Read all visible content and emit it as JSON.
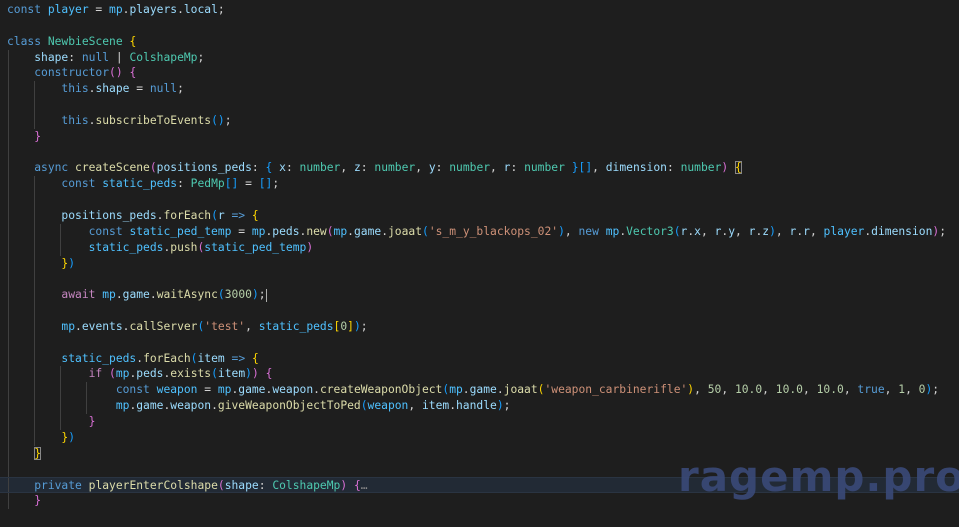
{
  "editor": {
    "lines": [
      {
        "indent": 0,
        "tokens": [
          [
            "kw",
            "const "
          ],
          [
            "var",
            "player"
          ],
          [
            "pl",
            " = "
          ],
          [
            "var",
            "mp"
          ],
          [
            "pl",
            "."
          ],
          [
            "prop",
            "players"
          ],
          [
            "pl",
            "."
          ],
          [
            "prop",
            "local"
          ],
          [
            "pl",
            ";"
          ]
        ]
      },
      {
        "indent": 0,
        "tokens": []
      },
      {
        "indent": 0,
        "tokens": [
          [
            "kw",
            "class "
          ],
          [
            "cls",
            "NewbieScene"
          ],
          [
            "pl",
            " "
          ],
          [
            "b1",
            "{"
          ]
        ]
      },
      {
        "indent": 1,
        "tokens": [
          [
            "prop",
            "shape"
          ],
          [
            "pl",
            ": "
          ],
          [
            "kw",
            "null"
          ],
          [
            "pl",
            " | "
          ],
          [
            "cls",
            "ColshapeMp"
          ],
          [
            "pl",
            ";"
          ]
        ]
      },
      {
        "indent": 1,
        "tokens": [
          [
            "kw",
            "constructor"
          ],
          [
            "b2",
            "()"
          ],
          [
            "pl",
            " "
          ],
          [
            "b2",
            "{"
          ]
        ]
      },
      {
        "indent": 2,
        "tokens": [
          [
            "kw",
            "this"
          ],
          [
            "pl",
            "."
          ],
          [
            "prop",
            "shape"
          ],
          [
            "pl",
            " = "
          ],
          [
            "kw",
            "null"
          ],
          [
            "pl",
            ";"
          ]
        ]
      },
      {
        "indent": 2,
        "tokens": []
      },
      {
        "indent": 2,
        "tokens": [
          [
            "kw",
            "this"
          ],
          [
            "pl",
            "."
          ],
          [
            "fn",
            "subscribeToEvents"
          ],
          [
            "b3",
            "()"
          ],
          [
            "pl",
            ";"
          ]
        ]
      },
      {
        "indent": 1,
        "tokens": [
          [
            "b2",
            "}"
          ]
        ]
      },
      {
        "indent": 1,
        "tokens": []
      },
      {
        "indent": 1,
        "tokens": [
          [
            "kw",
            "async "
          ],
          [
            "fn",
            "createScene"
          ],
          [
            "b2",
            "("
          ],
          [
            "prop",
            "positions_peds"
          ],
          [
            "pl",
            ": "
          ],
          [
            "b3",
            "{"
          ],
          [
            "pl",
            " "
          ],
          [
            "prop",
            "x"
          ],
          [
            "pl",
            ": "
          ],
          [
            "cls",
            "number"
          ],
          [
            "pl",
            ", "
          ],
          [
            "prop",
            "z"
          ],
          [
            "pl",
            ": "
          ],
          [
            "cls",
            "number"
          ],
          [
            "pl",
            ", "
          ],
          [
            "prop",
            "y"
          ],
          [
            "pl",
            ": "
          ],
          [
            "cls",
            "number"
          ],
          [
            "pl",
            ", "
          ],
          [
            "prop",
            "r"
          ],
          [
            "pl",
            ": "
          ],
          [
            "cls",
            "number"
          ],
          [
            "pl",
            " "
          ],
          [
            "b3",
            "}"
          ],
          [
            "b3",
            "[]"
          ],
          [
            "pl",
            ", "
          ],
          [
            "prop",
            "dimension"
          ],
          [
            "pl",
            ": "
          ],
          [
            "cls",
            "number"
          ],
          [
            "b2",
            ")"
          ],
          [
            "pl",
            " "
          ],
          [
            "b2m",
            "{"
          ]
        ]
      },
      {
        "indent": 2,
        "tokens": [
          [
            "kw",
            "const "
          ],
          [
            "var",
            "static_peds"
          ],
          [
            "pl",
            ": "
          ],
          [
            "cls",
            "PedMp"
          ],
          [
            "b3",
            "[]"
          ],
          [
            "pl",
            " = "
          ],
          [
            "b3",
            "[]"
          ],
          [
            "pl",
            ";"
          ]
        ]
      },
      {
        "indent": 2,
        "tokens": []
      },
      {
        "indent": 2,
        "tokens": [
          [
            "prop",
            "positions_peds"
          ],
          [
            "pl",
            "."
          ],
          [
            "fn",
            "forEach"
          ],
          [
            "b3",
            "("
          ],
          [
            "prop",
            "r"
          ],
          [
            "pl",
            " "
          ],
          [
            "kw",
            "=>"
          ],
          [
            "pl",
            " "
          ],
          [
            "b1",
            "{"
          ]
        ]
      },
      {
        "indent": 3,
        "tokens": [
          [
            "kw",
            "const "
          ],
          [
            "var",
            "static_ped_temp"
          ],
          [
            "pl",
            " = "
          ],
          [
            "var",
            "mp"
          ],
          [
            "pl",
            "."
          ],
          [
            "prop",
            "peds"
          ],
          [
            "pl",
            "."
          ],
          [
            "fn",
            "new"
          ],
          [
            "b2",
            "("
          ],
          [
            "var",
            "mp"
          ],
          [
            "pl",
            "."
          ],
          [
            "prop",
            "game"
          ],
          [
            "pl",
            "."
          ],
          [
            "fn",
            "joaat"
          ],
          [
            "b3",
            "("
          ],
          [
            "str",
            "'s_m_y_blackops_02'"
          ],
          [
            "b3",
            ")"
          ],
          [
            "pl",
            ", "
          ],
          [
            "kw",
            "new "
          ],
          [
            "var",
            "mp"
          ],
          [
            "pl",
            "."
          ],
          [
            "cls",
            "Vector3"
          ],
          [
            "b3",
            "("
          ],
          [
            "prop",
            "r"
          ],
          [
            "pl",
            "."
          ],
          [
            "prop",
            "x"
          ],
          [
            "pl",
            ", "
          ],
          [
            "prop",
            "r"
          ],
          [
            "pl",
            "."
          ],
          [
            "prop",
            "y"
          ],
          [
            "pl",
            ", "
          ],
          [
            "prop",
            "r"
          ],
          [
            "pl",
            "."
          ],
          [
            "prop",
            "z"
          ],
          [
            "b3",
            ")"
          ],
          [
            "pl",
            ", "
          ],
          [
            "prop",
            "r"
          ],
          [
            "pl",
            "."
          ],
          [
            "prop",
            "r"
          ],
          [
            "pl",
            ", "
          ],
          [
            "var",
            "player"
          ],
          [
            "pl",
            "."
          ],
          [
            "prop",
            "dimension"
          ],
          [
            "b2",
            ")"
          ],
          [
            "pl",
            ";"
          ]
        ]
      },
      {
        "indent": 3,
        "tokens": [
          [
            "var",
            "static_peds"
          ],
          [
            "pl",
            "."
          ],
          [
            "fn",
            "push"
          ],
          [
            "b2",
            "("
          ],
          [
            "var",
            "static_ped_temp"
          ],
          [
            "b2",
            ")"
          ]
        ]
      },
      {
        "indent": 2,
        "tokens": [
          [
            "b1",
            "}"
          ],
          [
            "b3",
            ")"
          ]
        ]
      },
      {
        "indent": 2,
        "tokens": []
      },
      {
        "indent": 2,
        "tokens": [
          [
            "ctl",
            "await "
          ],
          [
            "var",
            "mp"
          ],
          [
            "pl",
            "."
          ],
          [
            "prop",
            "game"
          ],
          [
            "pl",
            "."
          ],
          [
            "fn",
            "waitAsync"
          ],
          [
            "b3",
            "("
          ],
          [
            "num",
            "3000"
          ],
          [
            "b3",
            ")"
          ],
          [
            "pl",
            ";"
          ],
          [
            "cursor",
            ""
          ]
        ]
      },
      {
        "indent": 2,
        "tokens": []
      },
      {
        "indent": 2,
        "tokens": [
          [
            "var",
            "mp"
          ],
          [
            "pl",
            "."
          ],
          [
            "prop",
            "events"
          ],
          [
            "pl",
            "."
          ],
          [
            "fn",
            "callServer"
          ],
          [
            "b3",
            "("
          ],
          [
            "str",
            "'test'"
          ],
          [
            "pl",
            ", "
          ],
          [
            "var",
            "static_peds"
          ],
          [
            "b1",
            "["
          ],
          [
            "num",
            "0"
          ],
          [
            "b1",
            "]"
          ],
          [
            "b3",
            ")"
          ],
          [
            "pl",
            ";"
          ]
        ]
      },
      {
        "indent": 2,
        "tokens": []
      },
      {
        "indent": 2,
        "tokens": [
          [
            "var",
            "static_peds"
          ],
          [
            "pl",
            "."
          ],
          [
            "fn",
            "forEach"
          ],
          [
            "b3",
            "("
          ],
          [
            "prop",
            "item"
          ],
          [
            "pl",
            " "
          ],
          [
            "kw",
            "=>"
          ],
          [
            "pl",
            " "
          ],
          [
            "b1",
            "{"
          ]
        ]
      },
      {
        "indent": 3,
        "tokens": [
          [
            "ctl",
            "if "
          ],
          [
            "b2",
            "("
          ],
          [
            "var",
            "mp"
          ],
          [
            "pl",
            "."
          ],
          [
            "prop",
            "peds"
          ],
          [
            "pl",
            "."
          ],
          [
            "fn",
            "exists"
          ],
          [
            "b3",
            "("
          ],
          [
            "prop",
            "item"
          ],
          [
            "b3",
            ")"
          ],
          [
            "b2",
            ")"
          ],
          [
            "pl",
            " "
          ],
          [
            "b2",
            "{"
          ]
        ]
      },
      {
        "indent": 4,
        "tokens": [
          [
            "kw",
            "const "
          ],
          [
            "var",
            "weapon"
          ],
          [
            "pl",
            " = "
          ],
          [
            "var",
            "mp"
          ],
          [
            "pl",
            "."
          ],
          [
            "prop",
            "game"
          ],
          [
            "pl",
            "."
          ],
          [
            "prop",
            "weapon"
          ],
          [
            "pl",
            "."
          ],
          [
            "fn",
            "createWeaponObject"
          ],
          [
            "b3",
            "("
          ],
          [
            "var",
            "mp"
          ],
          [
            "pl",
            "."
          ],
          [
            "prop",
            "game"
          ],
          [
            "pl",
            "."
          ],
          [
            "fn",
            "joaat"
          ],
          [
            "b1",
            "("
          ],
          [
            "str",
            "'weapon_carbinerifle'"
          ],
          [
            "b1",
            ")"
          ],
          [
            "pl",
            ", "
          ],
          [
            "num",
            "50"
          ],
          [
            "pl",
            ", "
          ],
          [
            "num",
            "10.0"
          ],
          [
            "pl",
            ", "
          ],
          [
            "num",
            "10.0"
          ],
          [
            "pl",
            ", "
          ],
          [
            "num",
            "10.0"
          ],
          [
            "pl",
            ", "
          ],
          [
            "kw",
            "true"
          ],
          [
            "pl",
            ", "
          ],
          [
            "num",
            "1"
          ],
          [
            "pl",
            ", "
          ],
          [
            "num",
            "0"
          ],
          [
            "b3",
            ")"
          ],
          [
            "pl",
            ";"
          ]
        ]
      },
      {
        "indent": 4,
        "tokens": [
          [
            "var",
            "mp"
          ],
          [
            "pl",
            "."
          ],
          [
            "prop",
            "game"
          ],
          [
            "pl",
            "."
          ],
          [
            "prop",
            "weapon"
          ],
          [
            "pl",
            "."
          ],
          [
            "fn",
            "giveWeaponObjectToPed"
          ],
          [
            "b3",
            "("
          ],
          [
            "var",
            "weapon"
          ],
          [
            "pl",
            ", "
          ],
          [
            "prop",
            "item"
          ],
          [
            "pl",
            "."
          ],
          [
            "prop",
            "handle"
          ],
          [
            "b3",
            ")"
          ],
          [
            "pl",
            ";"
          ]
        ]
      },
      {
        "indent": 3,
        "tokens": [
          [
            "b2",
            "}"
          ]
        ]
      },
      {
        "indent": 2,
        "tokens": [
          [
            "b1",
            "}"
          ],
          [
            "b3",
            ")"
          ]
        ]
      },
      {
        "indent": 1,
        "tokens": [
          [
            "b2m",
            "}"
          ]
        ]
      },
      {
        "indent": 1,
        "tokens": []
      },
      {
        "indent": 1,
        "highlight": true,
        "tokens": [
          [
            "kw",
            "private "
          ],
          [
            "fn",
            "playerEnterColshape"
          ],
          [
            "b2",
            "("
          ],
          [
            "prop",
            "shape"
          ],
          [
            "pl",
            ": "
          ],
          [
            "cls",
            "ColshapeMp"
          ],
          [
            "b2",
            ")"
          ],
          [
            "pl",
            " "
          ],
          [
            "b2",
            "{"
          ],
          [
            "ell",
            "…"
          ]
        ]
      },
      {
        "indent": 1,
        "tokens": [
          [
            "b2",
            "}"
          ]
        ]
      }
    ]
  },
  "watermark": {
    "text": "ragemp.pro"
  },
  "colors": {
    "background": "#1e1e1e",
    "keyword": "#569cd6",
    "variable": "#4fc1ff",
    "property": "#9cdcfe",
    "function": "#dcdcaa",
    "type": "#4ec9b0",
    "string": "#ce9178",
    "number": "#b5cea8",
    "control": "#c586c0"
  }
}
